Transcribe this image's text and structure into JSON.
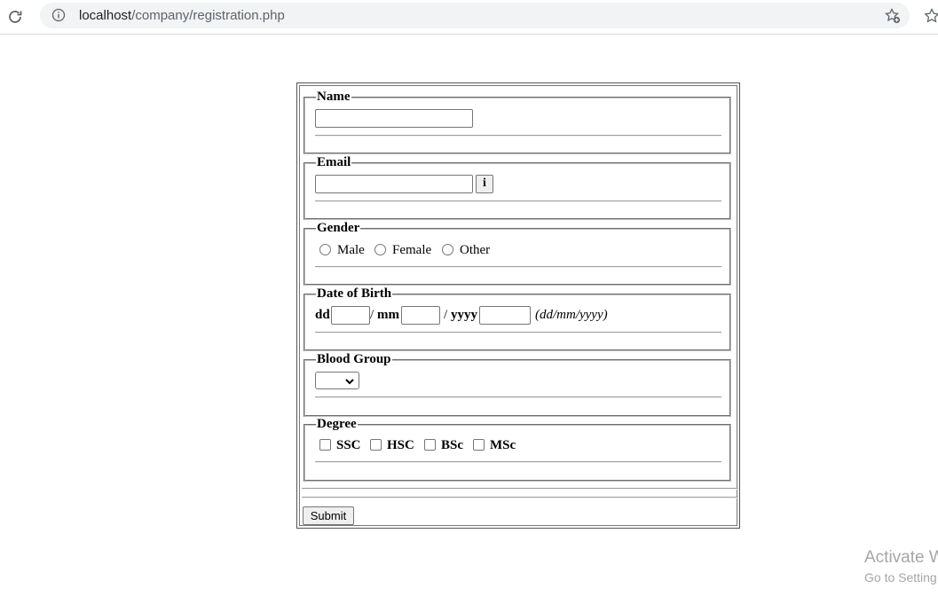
{
  "browser": {
    "url_host": "localhost",
    "url_path": "/company/registration.php",
    "icons": [
      "reload-icon",
      "info-icon",
      "bookmark-add-icon",
      "star-icon"
    ]
  },
  "form": {
    "name": {
      "legend": "Name",
      "value": ""
    },
    "email": {
      "legend": "Email",
      "value": "",
      "info_button": "i"
    },
    "gender": {
      "legend": "Gender",
      "options": [
        "Male",
        "Female",
        "Other"
      ],
      "selected": null
    },
    "dob": {
      "legend": "Date of Birth",
      "dd_label": "dd",
      "sep1": "/",
      "mm_label": "mm",
      "sep2": "/",
      "yyyy_label": "yyyy",
      "format_hint": "(dd/mm/yyyy)",
      "dd_value": "",
      "mm_value": "",
      "yyyy_value": ""
    },
    "blood_group": {
      "legend": "Blood Group",
      "selected": ""
    },
    "degree": {
      "legend": "Degree",
      "options": [
        "SSC",
        "HSC",
        "BSc",
        "MSc"
      ],
      "checked": []
    },
    "submit_label": "Submit"
  },
  "watermark": {
    "line1": "Activate W",
    "line2": "Go to Setting"
  }
}
